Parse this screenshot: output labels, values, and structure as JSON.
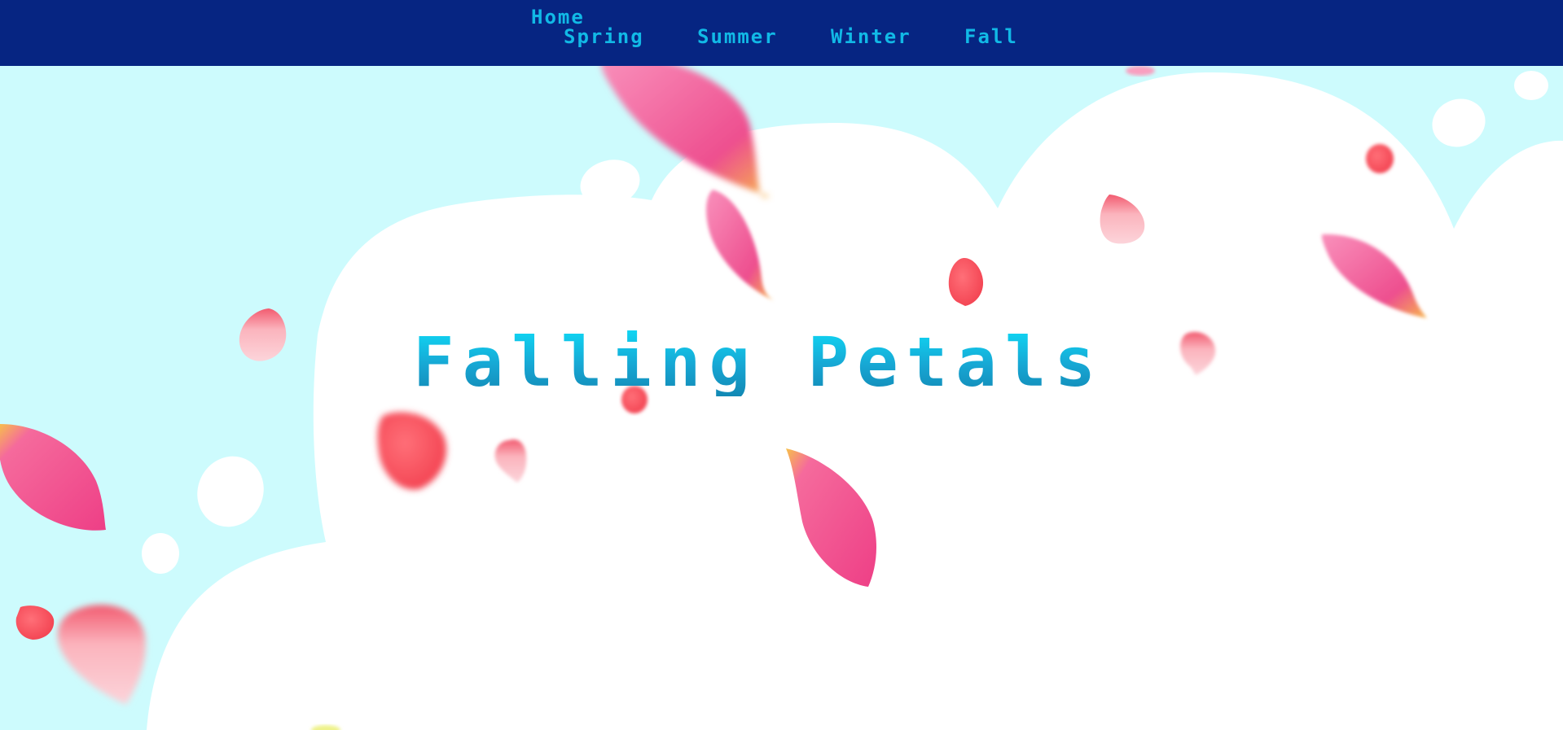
{
  "nav": {
    "home": "Home",
    "links": [
      "Spring",
      "Summer",
      "Winter",
      "Fall"
    ]
  },
  "hero": {
    "title": "Falling Petals"
  },
  "colors": {
    "navbar_bg": "#062582",
    "nav_link": "#11b9e6",
    "sky": "#cdfbfd",
    "cloud": "#ffffff",
    "title_top": "#0fd8f5",
    "title_bottom": "#1288b4",
    "petal_pink": "#f0508f",
    "petal_red": "#f5455a",
    "petal_tip": "#f7c14a"
  },
  "decorations": {
    "petal_icon": "petal-icon",
    "cloud_icon": "cloud-shape"
  }
}
